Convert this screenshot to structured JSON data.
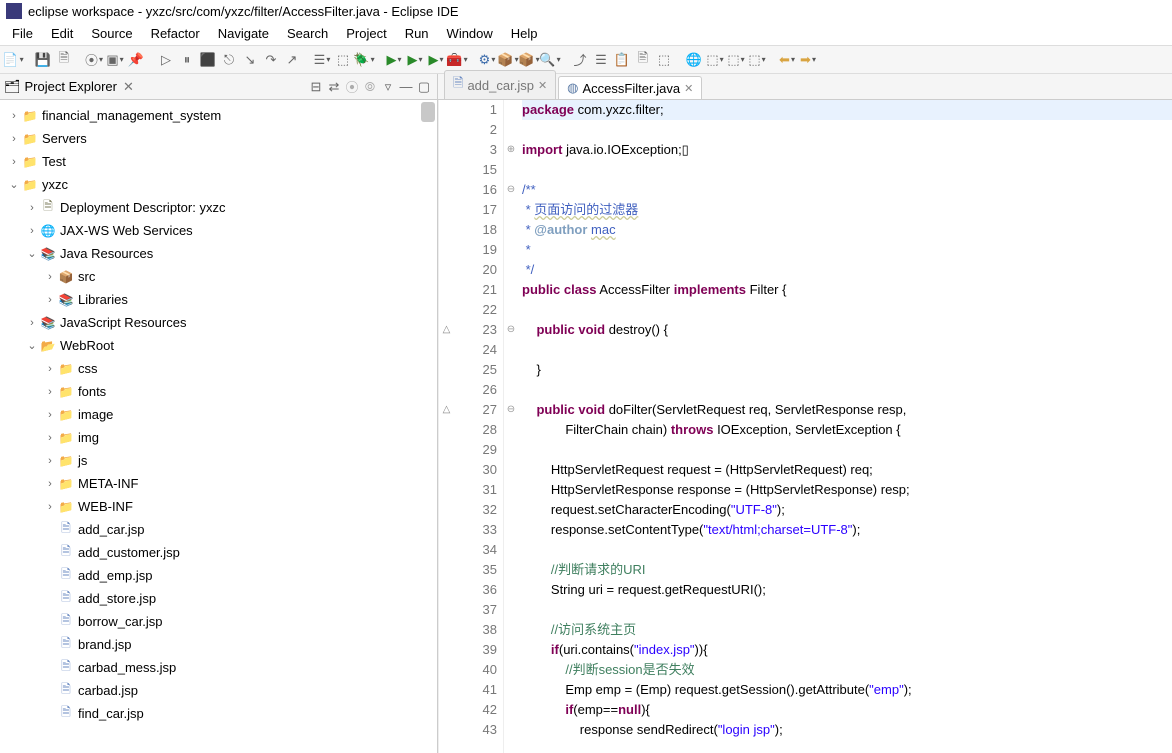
{
  "window": {
    "title": "eclipse workspace - yxzc/src/com/yxzc/filter/AccessFilter.java - Eclipse IDE"
  },
  "menu": [
    "File",
    "Edit",
    "Source",
    "Refactor",
    "Navigate",
    "Search",
    "Project",
    "Run",
    "Window",
    "Help"
  ],
  "projectExplorer": {
    "title": "Project Explorer",
    "tree": [
      {
        "depth": 0,
        "tw": ">",
        "icon": "proj",
        "label": "financial_management_system"
      },
      {
        "depth": 0,
        "tw": ">",
        "icon": "proj",
        "label": "Servers"
      },
      {
        "depth": 0,
        "tw": ">",
        "icon": "proj",
        "label": "Test"
      },
      {
        "depth": 0,
        "tw": "v",
        "icon": "proj",
        "label": "yxzc"
      },
      {
        "depth": 1,
        "tw": ">",
        "icon": "desc",
        "label": "Deployment Descriptor: yxzc"
      },
      {
        "depth": 1,
        "tw": ">",
        "icon": "ws",
        "label": "JAX-WS Web Services"
      },
      {
        "depth": 1,
        "tw": "v",
        "icon": "jres",
        "label": "Java Resources"
      },
      {
        "depth": 2,
        "tw": ">",
        "icon": "src",
        "label": "src"
      },
      {
        "depth": 2,
        "tw": ">",
        "icon": "lib",
        "label": "Libraries"
      },
      {
        "depth": 1,
        "tw": ">",
        "icon": "jsres",
        "label": "JavaScript Resources"
      },
      {
        "depth": 1,
        "tw": "v",
        "icon": "folder-open",
        "label": "WebRoot"
      },
      {
        "depth": 2,
        "tw": ">",
        "icon": "folder",
        "label": "css"
      },
      {
        "depth": 2,
        "tw": ">",
        "icon": "folder",
        "label": "fonts"
      },
      {
        "depth": 2,
        "tw": ">",
        "icon": "folder",
        "label": "image"
      },
      {
        "depth": 2,
        "tw": ">",
        "icon": "folder",
        "label": "img"
      },
      {
        "depth": 2,
        "tw": ">",
        "icon": "folder",
        "label": "js"
      },
      {
        "depth": 2,
        "tw": ">",
        "icon": "folder",
        "label": "META-INF"
      },
      {
        "depth": 2,
        "tw": ">",
        "icon": "folder",
        "label": "WEB-INF"
      },
      {
        "depth": 2,
        "tw": "",
        "icon": "jsp",
        "label": "add_car.jsp"
      },
      {
        "depth": 2,
        "tw": "",
        "icon": "jsp",
        "label": "add_customer.jsp"
      },
      {
        "depth": 2,
        "tw": "",
        "icon": "jsp",
        "label": "add_emp.jsp"
      },
      {
        "depth": 2,
        "tw": "",
        "icon": "jsp",
        "label": "add_store.jsp"
      },
      {
        "depth": 2,
        "tw": "",
        "icon": "jsp",
        "label": "borrow_car.jsp"
      },
      {
        "depth": 2,
        "tw": "",
        "icon": "jsp",
        "label": "brand.jsp"
      },
      {
        "depth": 2,
        "tw": "",
        "icon": "jsp",
        "label": "carbad_mess.jsp"
      },
      {
        "depth": 2,
        "tw": "",
        "icon": "jsp",
        "label": "carbad.jsp"
      },
      {
        "depth": 2,
        "tw": "",
        "icon": "jsp",
        "label": "find_car.jsp"
      }
    ]
  },
  "editorTabs": [
    {
      "label": "add_car.jsp",
      "active": false,
      "icon": "jsp"
    },
    {
      "label": "AccessFilter.java",
      "active": true,
      "icon": "java"
    }
  ],
  "code": {
    "lines": [
      {
        "n": 1,
        "fold": "",
        "html": "<span class='hl'><span class='kw'>package</span> com.yxzc.filter;</span>"
      },
      {
        "n": 2,
        "fold": "",
        "html": ""
      },
      {
        "n": 3,
        "fold": "⊕",
        "html": "<span class='kw'>import</span> java.io.IOException;▯"
      },
      {
        "n": 15,
        "fold": "",
        "html": ""
      },
      {
        "n": 16,
        "fold": "⊖",
        "html": "<span class='doc'>/**</span>"
      },
      {
        "n": 17,
        "fold": "",
        "html": "<span class='doc'> * <span class='ann'>页面访问的过滤器</span></span>"
      },
      {
        "n": 18,
        "fold": "",
        "html": "<span class='doc'> * <span class='doctag'>@author</span> <span class='ann'>mac</span></span>"
      },
      {
        "n": 19,
        "fold": "",
        "html": "<span class='doc'> *</span>"
      },
      {
        "n": 20,
        "fold": "",
        "html": "<span class='doc'> */</span>"
      },
      {
        "n": 21,
        "fold": "",
        "html": "<span class='kw'>public</span> <span class='kw'>class</span> AccessFilter <span class='kw'>implements</span> Filter {"
      },
      {
        "n": 22,
        "fold": "",
        "html": ""
      },
      {
        "n": 23,
        "fold": "⊖",
        "mark": "△",
        "html": "    <span class='kw'>public</span> <span class='kw'>void</span> destroy() {"
      },
      {
        "n": 24,
        "fold": "",
        "html": ""
      },
      {
        "n": 25,
        "fold": "",
        "html": "    }"
      },
      {
        "n": 26,
        "fold": "",
        "html": ""
      },
      {
        "n": 27,
        "fold": "⊖",
        "mark": "△",
        "html": "    <span class='kw'>public</span> <span class='kw'>void</span> doFilter(ServletRequest req, ServletResponse resp,"
      },
      {
        "n": 28,
        "fold": "",
        "html": "            FilterChain chain) <span class='kw'>throws</span> IOException, ServletException {"
      },
      {
        "n": 29,
        "fold": "",
        "html": ""
      },
      {
        "n": 30,
        "fold": "",
        "html": "        HttpServletRequest request = (HttpServletRequest) req;"
      },
      {
        "n": 31,
        "fold": "",
        "html": "        HttpServletResponse response = (HttpServletResponse) resp;"
      },
      {
        "n": 32,
        "fold": "",
        "html": "        request.setCharacterEncoding(<span class='str'>\"UTF-8\"</span>);"
      },
      {
        "n": 33,
        "fold": "",
        "html": "        response.setContentType(<span class='str'>\"text/html;charset=UTF-8\"</span>);"
      },
      {
        "n": 34,
        "fold": "",
        "html": ""
      },
      {
        "n": 35,
        "fold": "",
        "html": "        <span class='cmt'>//判断请求的URI</span>"
      },
      {
        "n": 36,
        "fold": "",
        "html": "        String uri = request.getRequestURI();"
      },
      {
        "n": 37,
        "fold": "",
        "html": ""
      },
      {
        "n": 38,
        "fold": "",
        "html": "        <span class='cmt'>//访问系统主页</span>"
      },
      {
        "n": 39,
        "fold": "",
        "html": "        <span class='kw'>if</span>(uri.contains(<span class='str'>\"index.jsp\"</span>)){"
      },
      {
        "n": 40,
        "fold": "",
        "html": "            <span class='cmt'>//判断session是否失效</span>"
      },
      {
        "n": 41,
        "fold": "",
        "html": "            Emp emp = (Emp) request.getSession().getAttribute(<span class='str'>\"emp\"</span>);"
      },
      {
        "n": 42,
        "fold": "",
        "html": "            <span class='kw'>if</span>(emp==<span class='kw'>null</span>){"
      },
      {
        "n": 43,
        "fold": "",
        "html": "                response sendRedirect(<span class='str'>\"login jsp\"</span>);"
      }
    ]
  }
}
